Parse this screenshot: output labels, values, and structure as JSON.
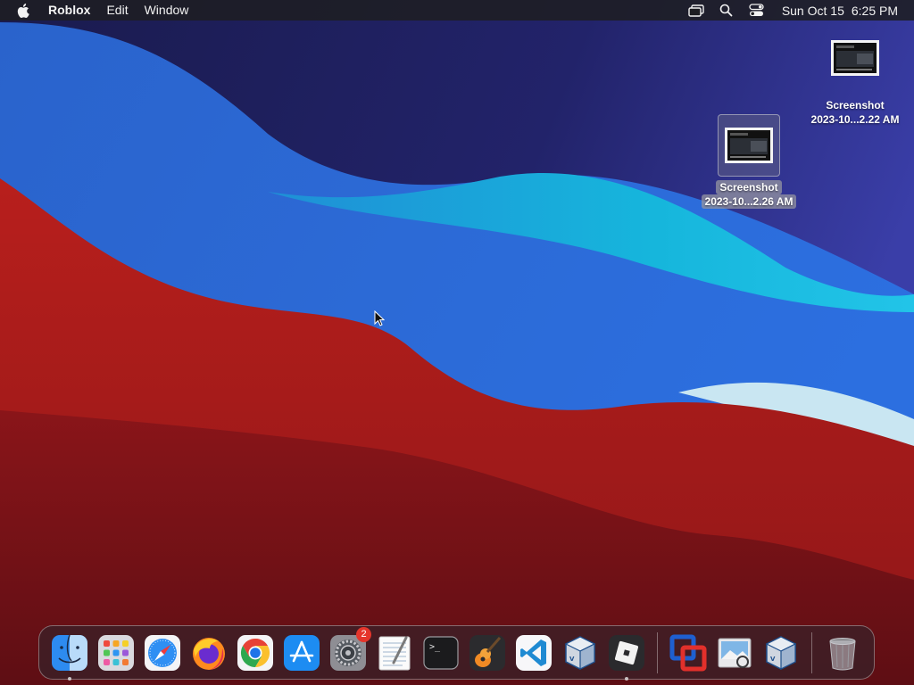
{
  "menubar": {
    "apple": "apple-logo-icon",
    "app_name": "Roblox",
    "menus": [
      "Edit",
      "Window"
    ],
    "status_icons": [
      "screen-mirroring-icon",
      "spotlight-search-icon",
      "control-center-icon"
    ],
    "date": "Sun Oct 15",
    "time": "6:25 PM"
  },
  "desktop": {
    "icons": [
      {
        "name_line1": "Screenshot",
        "name_line2": "2023-10...2.22 AM",
        "selected": false
      },
      {
        "name_line1": "Screenshot",
        "name_line2": "2023-10...2.26 AM",
        "selected": true
      }
    ]
  },
  "dock": {
    "apps": [
      {
        "name": "Finder",
        "icon": "finder-icon",
        "running": true
      },
      {
        "name": "Launchpad",
        "icon": "launchpad-icon",
        "running": false
      },
      {
        "name": "Safari",
        "icon": "safari-icon",
        "running": false
      },
      {
        "name": "Firefox",
        "icon": "firefox-icon",
        "running": false
      },
      {
        "name": "Google Chrome",
        "icon": "chrome-icon",
        "running": false
      },
      {
        "name": "App Store",
        "icon": "app-store-icon",
        "running": false
      },
      {
        "name": "System Settings",
        "icon": "system-settings-icon",
        "running": false,
        "badge": "2"
      },
      {
        "name": "TextEdit",
        "icon": "textedit-icon",
        "running": false
      },
      {
        "name": "Terminal",
        "icon": "terminal-icon",
        "running": false
      },
      {
        "name": "GarageBand",
        "icon": "garageband-icon",
        "running": false
      },
      {
        "name": "Visual Studio Code",
        "icon": "vscode-icon",
        "running": false
      },
      {
        "name": "VirtualBox",
        "icon": "virtualbox-icon",
        "running": false
      },
      {
        "name": "Roblox",
        "icon": "roblox-icon",
        "running": true
      }
    ],
    "recents": [
      {
        "name": "Parallels",
        "icon": "parallels-icon"
      },
      {
        "name": "Preview",
        "icon": "preview-icon"
      },
      {
        "name": "VirtualBox",
        "icon": "virtualbox-icon"
      }
    ],
    "trash": {
      "name": "Trash",
      "icon": "trash-icon"
    }
  },
  "colors": {
    "wallpaper_top": "#1d1f55",
    "wallpaper_blue": "#2a55c8",
    "wallpaper_cyan": "#1ab0d8",
    "wallpaper_red": "#b2221f",
    "wallpaper_dark_red": "#7a1217",
    "badge": "#e5352b"
  }
}
